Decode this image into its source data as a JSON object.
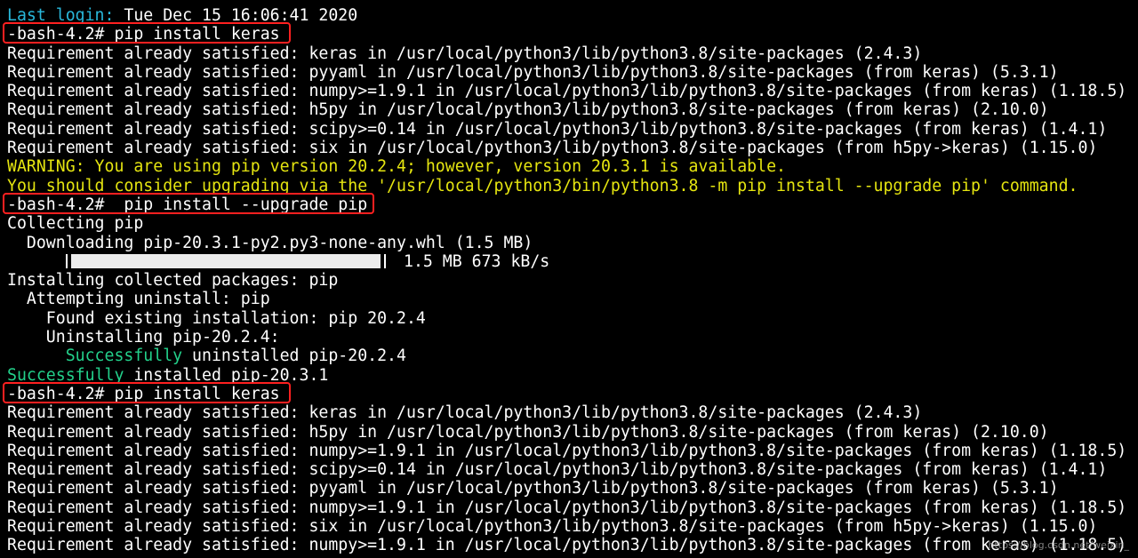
{
  "terminal": {
    "lines": [
      {
        "segments": [
          {
            "text": "Last login:",
            "color": "cyan"
          },
          {
            "text": " Tue Dec 15 16:06:41 2020",
            "color": "white"
          }
        ]
      },
      {
        "segments": [
          {
            "text": "-bash-4.2# pip install keras",
            "color": "white"
          }
        ],
        "highlight": true
      },
      {
        "segments": [
          {
            "text": "Requirement already satisfied: keras in /usr/local/python3/lib/python3.8/site-packages (2.4.3)",
            "color": "white"
          }
        ]
      },
      {
        "segments": [
          {
            "text": "Requirement already satisfied: pyyaml in /usr/local/python3/lib/python3.8/site-packages (from keras) (5.3.1)",
            "color": "white"
          }
        ]
      },
      {
        "segments": [
          {
            "text": "Requirement already satisfied: numpy>=1.9.1 in /usr/local/python3/lib/python3.8/site-packages (from keras) (1.18.5)",
            "color": "white"
          }
        ]
      },
      {
        "segments": [
          {
            "text": "Requirement already satisfied: h5py in /usr/local/python3/lib/python3.8/site-packages (from keras) (2.10.0)",
            "color": "white"
          }
        ]
      },
      {
        "segments": [
          {
            "text": "Requirement already satisfied: scipy>=0.14 in /usr/local/python3/lib/python3.8/site-packages (from keras) (1.4.1)",
            "color": "white"
          }
        ]
      },
      {
        "segments": [
          {
            "text": "Requirement already satisfied: six in /usr/local/python3/lib/python3.8/site-packages (from h5py->keras) (1.15.0)",
            "color": "white"
          }
        ]
      },
      {
        "segments": [
          {
            "text": "WARNING: You are using pip version 20.2.4; however, version 20.3.1 is available.",
            "color": "yellow"
          }
        ]
      },
      {
        "segments": [
          {
            "text": "You should consider upgrading via the '/usr/local/python3/bin/python3.8 -m pip install --upgrade pip' command.",
            "color": "yellow"
          }
        ]
      },
      {
        "segments": [
          {
            "text": "-bash-4.2#  pip install --upgrade pip",
            "color": "white"
          }
        ],
        "highlight": true
      },
      {
        "segments": [
          {
            "text": "Collecting pip",
            "color": "white"
          }
        ]
      },
      {
        "segments": [
          {
            "text": "  Downloading pip-20.3.1-py2.py3-none-any.whl (1.5 MB)",
            "color": "white"
          }
        ]
      },
      {
        "progress": {
          "fraction": 1.0,
          "text": "1.5 MB 673 kB/s"
        }
      },
      {
        "segments": [
          {
            "text": "Installing collected packages: pip",
            "color": "white"
          }
        ]
      },
      {
        "segments": [
          {
            "text": "  Attempting uninstall: pip",
            "color": "white"
          }
        ]
      },
      {
        "segments": [
          {
            "text": "    Found existing installation: pip 20.2.4",
            "color": "white"
          }
        ]
      },
      {
        "segments": [
          {
            "text": "    Uninstalling pip-20.2.4:",
            "color": "white"
          }
        ]
      },
      {
        "segments": [
          {
            "text": "      ",
            "color": "white"
          },
          {
            "text": "Successfully",
            "color": "green"
          },
          {
            "text": " uninstalled pip-20.2.4",
            "color": "white"
          }
        ]
      },
      {
        "segments": [
          {
            "text": "Successfully",
            "color": "green"
          },
          {
            "text": " installed pip-20.3.1",
            "color": "white"
          }
        ]
      },
      {
        "segments": [
          {
            "text": "-bash-4.2# pip install keras",
            "color": "white"
          }
        ],
        "highlight": true
      },
      {
        "segments": [
          {
            "text": "Requirement already satisfied: keras in /usr/local/python3/lib/python3.8/site-packages (2.4.3)",
            "color": "white"
          }
        ]
      },
      {
        "segments": [
          {
            "text": "Requirement already satisfied: h5py in /usr/local/python3/lib/python3.8/site-packages (from keras) (2.10.0)",
            "color": "white"
          }
        ]
      },
      {
        "segments": [
          {
            "text": "Requirement already satisfied: numpy>=1.9.1 in /usr/local/python3/lib/python3.8/site-packages (from keras) (1.18.5)",
            "color": "white"
          }
        ]
      },
      {
        "segments": [
          {
            "text": "Requirement already satisfied: scipy>=0.14 in /usr/local/python3/lib/python3.8/site-packages (from keras) (1.4.1)",
            "color": "white"
          }
        ]
      },
      {
        "segments": [
          {
            "text": "Requirement already satisfied: pyyaml in /usr/local/python3/lib/python3.8/site-packages (from keras) (5.3.1)",
            "color": "white"
          }
        ]
      },
      {
        "segments": [
          {
            "text": "Requirement already satisfied: numpy>=1.9.1 in /usr/local/python3/lib/python3.8/site-packages (from keras) (1.18.5)",
            "color": "white"
          }
        ]
      },
      {
        "segments": [
          {
            "text": "Requirement already satisfied: six in /usr/local/python3/lib/python3.8/site-packages (from h5py->keras) (1.15.0)",
            "color": "white"
          }
        ]
      },
      {
        "segments": [
          {
            "text": "Requirement already satisfied: numpy>=1.9.1 in /usr/local/python3/lib/python3.8/site-packages (from keras) (1.18.5)",
            "color": "white"
          }
        ]
      }
    ]
  },
  "colors": {
    "background": "#000000",
    "text": "#ffffff",
    "cyan": "#29b8db",
    "yellow": "#e5e510",
    "green": "#23d18b",
    "highlight_border": "#ff2020"
  },
  "watermark": {
    "text": "https://blog.csdn.net/weixin_"
  }
}
